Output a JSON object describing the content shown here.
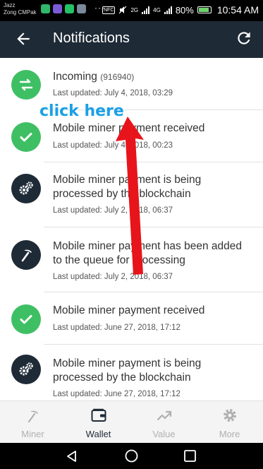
{
  "status_bar": {
    "carrier_1": "Jazz",
    "carrier_2": "Zong CMPak",
    "overflow_dots": "···",
    "nfc": "NFC",
    "signal_1": "2G",
    "signal_2": "4G",
    "battery": "80%",
    "time": "10:54 AM"
  },
  "app_bar": {
    "title": "Notifications"
  },
  "notifications": [
    {
      "title": "Incoming",
      "id": "(916940)",
      "updated": "Last updated: July 4, 2018, 03:29",
      "icon": "transfer-icon",
      "color": "#3fbf64"
    },
    {
      "title": "Mobile miner payment received",
      "updated": "Last updated: July 4, 2018, 00:23",
      "icon": "check-icon",
      "color": "#3fbf64"
    },
    {
      "title": "Mobile miner payment is being processed by the blockchain",
      "updated": "Last updated: July 2, 2018, 06:37",
      "icon": "gears-icon",
      "color": "#1e2a36"
    },
    {
      "title": "Mobile miner payment has been added to the queue for processing",
      "updated": "Last updated: July 2, 2018, 06:37",
      "icon": "pickaxe-icon",
      "color": "#1e2a36"
    },
    {
      "title": "Mobile miner payment received",
      "updated": "Last updated: June 27, 2018, 17:12",
      "icon": "check-icon",
      "color": "#3fbf64"
    },
    {
      "title": "Mobile miner payment is being processed by the blockchain",
      "updated": "Last updated: June 27, 2018, 17:12",
      "icon": "gears-icon",
      "color": "#1e2a36"
    }
  ],
  "bottom_nav": [
    {
      "label": "Miner",
      "icon": "pickaxe-icon",
      "active": false
    },
    {
      "label": "Wallet",
      "icon": "wallet-icon",
      "active": true
    },
    {
      "label": "Value",
      "icon": "chart-icon",
      "active": false
    },
    {
      "label": "More",
      "icon": "gear-icon",
      "active": false
    }
  ],
  "annotation": {
    "text": "click here",
    "color": "#1aa0e6",
    "arrow_color": "#e8141b"
  }
}
